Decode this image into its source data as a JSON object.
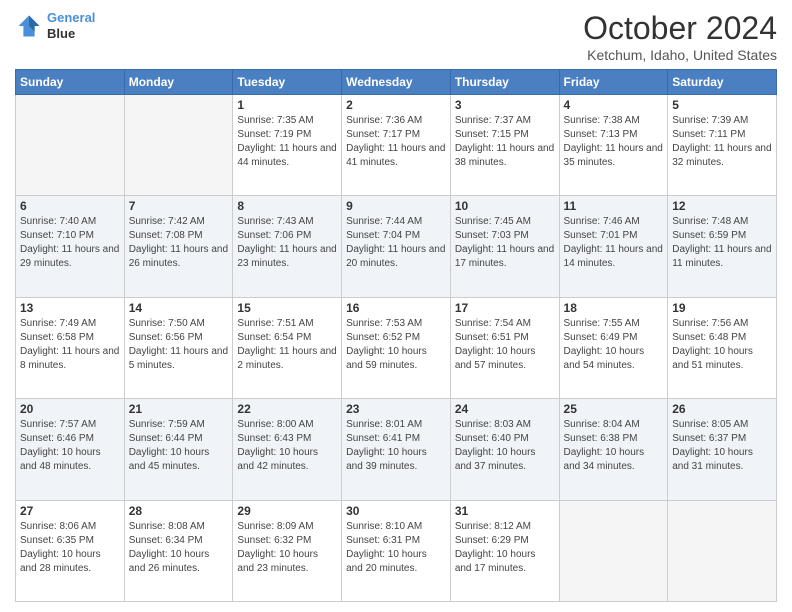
{
  "logo": {
    "line1": "General",
    "line2": "Blue"
  },
  "title": "October 2024",
  "subtitle": "Ketchum, Idaho, United States",
  "days_of_week": [
    "Sunday",
    "Monday",
    "Tuesday",
    "Wednesday",
    "Thursday",
    "Friday",
    "Saturday"
  ],
  "weeks": [
    [
      {
        "day": "",
        "empty": true
      },
      {
        "day": "",
        "empty": true
      },
      {
        "day": "1",
        "sunrise": "Sunrise: 7:35 AM",
        "sunset": "Sunset: 7:19 PM",
        "daylight": "Daylight: 11 hours and 44 minutes."
      },
      {
        "day": "2",
        "sunrise": "Sunrise: 7:36 AM",
        "sunset": "Sunset: 7:17 PM",
        "daylight": "Daylight: 11 hours and 41 minutes."
      },
      {
        "day": "3",
        "sunrise": "Sunrise: 7:37 AM",
        "sunset": "Sunset: 7:15 PM",
        "daylight": "Daylight: 11 hours and 38 minutes."
      },
      {
        "day": "4",
        "sunrise": "Sunrise: 7:38 AM",
        "sunset": "Sunset: 7:13 PM",
        "daylight": "Daylight: 11 hours and 35 minutes."
      },
      {
        "day": "5",
        "sunrise": "Sunrise: 7:39 AM",
        "sunset": "Sunset: 7:11 PM",
        "daylight": "Daylight: 11 hours and 32 minutes."
      }
    ],
    [
      {
        "day": "6",
        "sunrise": "Sunrise: 7:40 AM",
        "sunset": "Sunset: 7:10 PM",
        "daylight": "Daylight: 11 hours and 29 minutes."
      },
      {
        "day": "7",
        "sunrise": "Sunrise: 7:42 AM",
        "sunset": "Sunset: 7:08 PM",
        "daylight": "Daylight: 11 hours and 26 minutes."
      },
      {
        "day": "8",
        "sunrise": "Sunrise: 7:43 AM",
        "sunset": "Sunset: 7:06 PM",
        "daylight": "Daylight: 11 hours and 23 minutes."
      },
      {
        "day": "9",
        "sunrise": "Sunrise: 7:44 AM",
        "sunset": "Sunset: 7:04 PM",
        "daylight": "Daylight: 11 hours and 20 minutes."
      },
      {
        "day": "10",
        "sunrise": "Sunrise: 7:45 AM",
        "sunset": "Sunset: 7:03 PM",
        "daylight": "Daylight: 11 hours and 17 minutes."
      },
      {
        "day": "11",
        "sunrise": "Sunrise: 7:46 AM",
        "sunset": "Sunset: 7:01 PM",
        "daylight": "Daylight: 11 hours and 14 minutes."
      },
      {
        "day": "12",
        "sunrise": "Sunrise: 7:48 AM",
        "sunset": "Sunset: 6:59 PM",
        "daylight": "Daylight: 11 hours and 11 minutes."
      }
    ],
    [
      {
        "day": "13",
        "sunrise": "Sunrise: 7:49 AM",
        "sunset": "Sunset: 6:58 PM",
        "daylight": "Daylight: 11 hours and 8 minutes."
      },
      {
        "day": "14",
        "sunrise": "Sunrise: 7:50 AM",
        "sunset": "Sunset: 6:56 PM",
        "daylight": "Daylight: 11 hours and 5 minutes."
      },
      {
        "day": "15",
        "sunrise": "Sunrise: 7:51 AM",
        "sunset": "Sunset: 6:54 PM",
        "daylight": "Daylight: 11 hours and 2 minutes."
      },
      {
        "day": "16",
        "sunrise": "Sunrise: 7:53 AM",
        "sunset": "Sunset: 6:52 PM",
        "daylight": "Daylight: 10 hours and 59 minutes."
      },
      {
        "day": "17",
        "sunrise": "Sunrise: 7:54 AM",
        "sunset": "Sunset: 6:51 PM",
        "daylight": "Daylight: 10 hours and 57 minutes."
      },
      {
        "day": "18",
        "sunrise": "Sunrise: 7:55 AM",
        "sunset": "Sunset: 6:49 PM",
        "daylight": "Daylight: 10 hours and 54 minutes."
      },
      {
        "day": "19",
        "sunrise": "Sunrise: 7:56 AM",
        "sunset": "Sunset: 6:48 PM",
        "daylight": "Daylight: 10 hours and 51 minutes."
      }
    ],
    [
      {
        "day": "20",
        "sunrise": "Sunrise: 7:57 AM",
        "sunset": "Sunset: 6:46 PM",
        "daylight": "Daylight: 10 hours and 48 minutes."
      },
      {
        "day": "21",
        "sunrise": "Sunrise: 7:59 AM",
        "sunset": "Sunset: 6:44 PM",
        "daylight": "Daylight: 10 hours and 45 minutes."
      },
      {
        "day": "22",
        "sunrise": "Sunrise: 8:00 AM",
        "sunset": "Sunset: 6:43 PM",
        "daylight": "Daylight: 10 hours and 42 minutes."
      },
      {
        "day": "23",
        "sunrise": "Sunrise: 8:01 AM",
        "sunset": "Sunset: 6:41 PM",
        "daylight": "Daylight: 10 hours and 39 minutes."
      },
      {
        "day": "24",
        "sunrise": "Sunrise: 8:03 AM",
        "sunset": "Sunset: 6:40 PM",
        "daylight": "Daylight: 10 hours and 37 minutes."
      },
      {
        "day": "25",
        "sunrise": "Sunrise: 8:04 AM",
        "sunset": "Sunset: 6:38 PM",
        "daylight": "Daylight: 10 hours and 34 minutes."
      },
      {
        "day": "26",
        "sunrise": "Sunrise: 8:05 AM",
        "sunset": "Sunset: 6:37 PM",
        "daylight": "Daylight: 10 hours and 31 minutes."
      }
    ],
    [
      {
        "day": "27",
        "sunrise": "Sunrise: 8:06 AM",
        "sunset": "Sunset: 6:35 PM",
        "daylight": "Daylight: 10 hours and 28 minutes."
      },
      {
        "day": "28",
        "sunrise": "Sunrise: 8:08 AM",
        "sunset": "Sunset: 6:34 PM",
        "daylight": "Daylight: 10 hours and 26 minutes."
      },
      {
        "day": "29",
        "sunrise": "Sunrise: 8:09 AM",
        "sunset": "Sunset: 6:32 PM",
        "daylight": "Daylight: 10 hours and 23 minutes."
      },
      {
        "day": "30",
        "sunrise": "Sunrise: 8:10 AM",
        "sunset": "Sunset: 6:31 PM",
        "daylight": "Daylight: 10 hours and 20 minutes."
      },
      {
        "day": "31",
        "sunrise": "Sunrise: 8:12 AM",
        "sunset": "Sunset: 6:29 PM",
        "daylight": "Daylight: 10 hours and 17 minutes."
      },
      {
        "day": "",
        "empty": true
      },
      {
        "day": "",
        "empty": true
      }
    ]
  ]
}
